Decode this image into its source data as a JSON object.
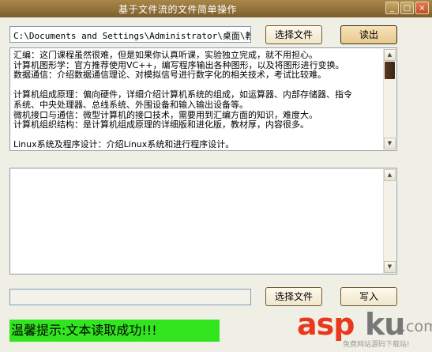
{
  "window": {
    "title": "基于文件流的文件简单操作",
    "controls": {
      "minimize": "_",
      "maximize": "□",
      "close": "×"
    }
  },
  "top": {
    "path_value": "C:\\Documents and Settings\\Administrator\\桌面\\教材.",
    "select_label": "选择文件",
    "read_label": "读出"
  },
  "content_lines": [
    "汇编：这门课程虽然很难，但是如果你认真听课，实验独立完成，就不用担心。",
    "计算机图形学：官方推荐使用VC++，编写程序输出各种图形，以及将图形进行变换。",
    "数据通信：介绍数据通信理论、对模拟信号进行数字化的相关技术，考试比较难。",
    "",
    "计算机组成原理：偏向硬件，详细介绍计算机系统的组成，如运算器、内部存储器、指令",
    "系统、中央处理器、总线系统、外围设备和输入输出设备等。",
    "微机接口与通信：微型计算机的接口技术，需要用到汇编方面的知识，难度大。",
    "计算机组织结构：是计算机组成原理的详细版和进化版，教材厚，内容很多。",
    "",
    "Linux系统及程序设计：介绍Linux系统和进行程序设计。"
  ],
  "bottom": {
    "path_value": "",
    "select_label": "选择文件",
    "write_label": "写入"
  },
  "status": {
    "text": "温馨提示:文本读取成功!!!",
    "color": "#31e51f"
  },
  "watermark": {
    "asp": "asp",
    "ku": "ku",
    "com": ".com",
    "sub": "免费网站源码下载站!"
  }
}
